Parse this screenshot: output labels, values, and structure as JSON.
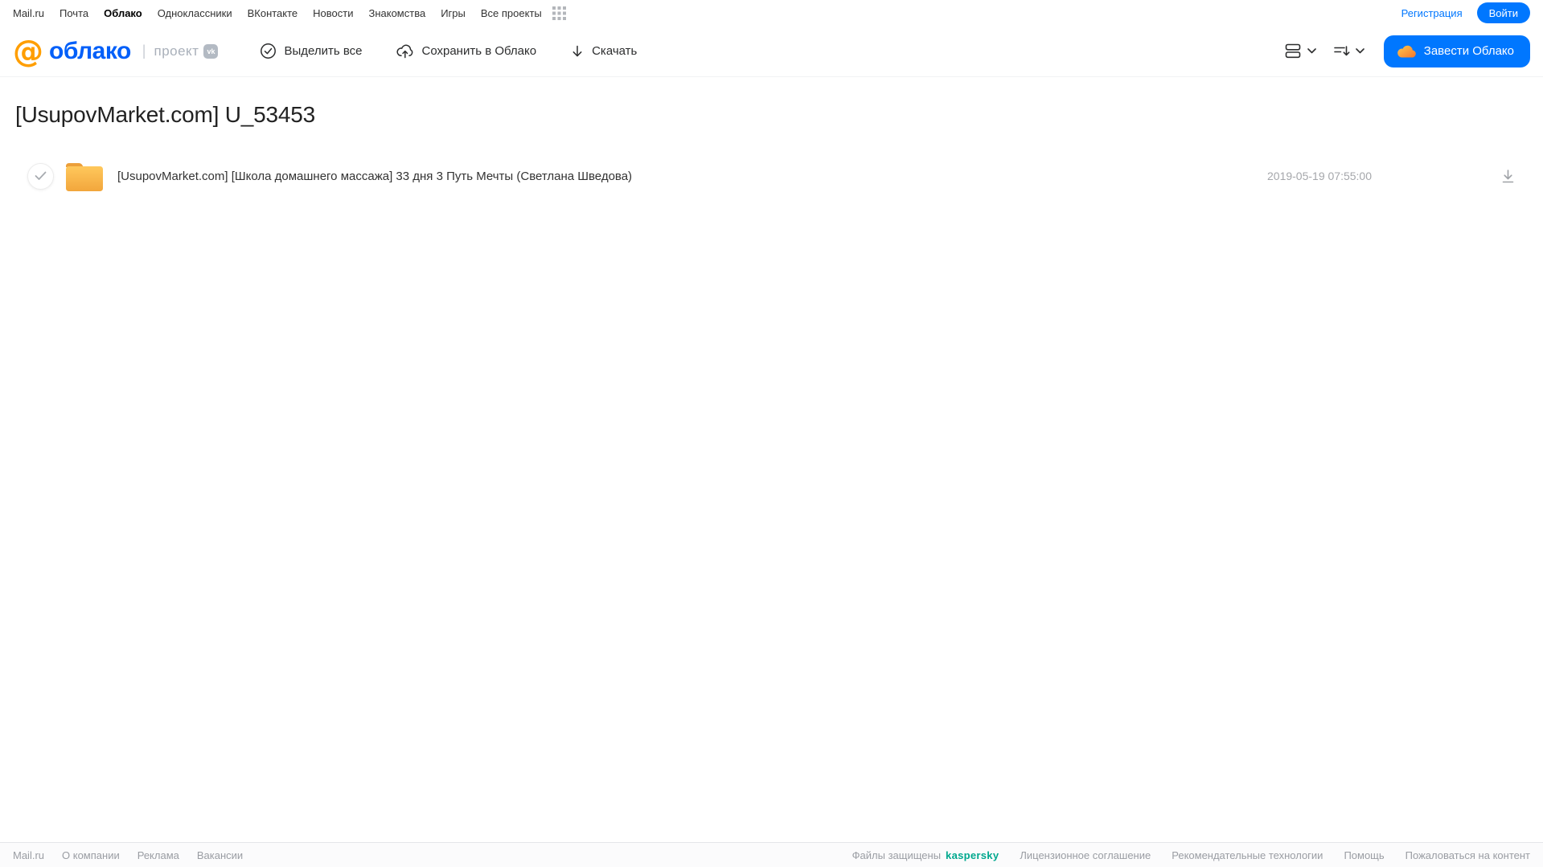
{
  "topnav": {
    "items": [
      "Mail.ru",
      "Почта",
      "Облако",
      "Одноклассники",
      "ВКонтакте",
      "Новости",
      "Знакомства",
      "Игры",
      "Все проекты"
    ],
    "active_item": "Облако",
    "register_label": "Регистрация",
    "login_label": "Войти"
  },
  "header": {
    "logo_at": "@",
    "logo_text": "облако",
    "logo_divider": "|",
    "project_label": "проект",
    "vk_badge": "vk",
    "toolbar": {
      "select_all": "Выделить все",
      "save_to_cloud": "Сохранить в Облако",
      "download": "Скачать"
    },
    "get_cloud_button": "Завести Облако"
  },
  "main": {
    "title": "[UsupovMarket.com] U_53453",
    "files": [
      {
        "name": "[UsupovMarket.com] [Школа домашнего массажа] 33 дня 3 Путь Мечты (Светлана Шведова)",
        "date": "2019-05-19 07:55:00"
      }
    ]
  },
  "footer": {
    "left_links": [
      "Mail.ru",
      "О компании",
      "Реклама",
      "Вакансии"
    ],
    "protected_label": "Файлы защищены",
    "kaspersky_label": "kaspersky",
    "right_links": [
      "Лицензионное соглашение",
      "Рекомендательные технологии",
      "Помощь",
      "Пожаловаться на контент"
    ]
  },
  "colors": {
    "primary_blue": "#0077FF",
    "logo_blue": "#005FF9",
    "logo_orange": "#FF9E00",
    "folder_yellow": "#F5B041",
    "kaspersky_teal": "#00A88E"
  }
}
